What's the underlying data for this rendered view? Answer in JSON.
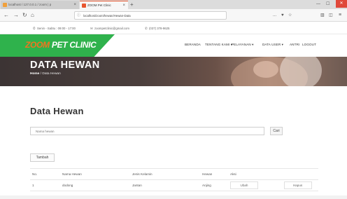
{
  "browser": {
    "tabs": [
      {
        "title": "localhost / 127.0.0.1 / zoom | p",
        "favicon_color": "#f0a03c"
      },
      {
        "title": "ZOOM Pet Clinic",
        "favicon_color": "#e8552f"
      }
    ],
    "new_tab": "+",
    "url": "localhost/zoom/hewan/Hewan-Data",
    "menu_glyph": "...",
    "nav": {
      "back": "←",
      "forward": "→",
      "reload": "↻",
      "home": "⌂"
    }
  },
  "infobar": {
    "hours": "Senin - Sabtu : 09:00 - 17:00",
    "email": "zoompetclinic@gmail.com",
    "phone": "(037) 378-9625"
  },
  "header": {
    "logo_zoom": "ZOOM",
    "logo_rest": "PET CLINIC",
    "logo_color": "#2fb24c",
    "menu": [
      "BERANDA",
      "TENTANG KAMI ▾",
      "PELAYANAN ▾",
      "DATA USER ▾",
      "ANTRI",
      "LOGOUT"
    ]
  },
  "hero": {
    "title": "DATA HEWAN",
    "crumb_home": "Home",
    "crumb_sep": "/",
    "crumb_current": "Data Hewan"
  },
  "main": {
    "title": "Data Hewan",
    "search_placeholder": "Nama hewan",
    "search_button": "Cari",
    "add_button": "Tambah",
    "table": {
      "headers": [
        "No.",
        "Nama Hewan",
        "Jenis Kelamin",
        "Hewan",
        "Aksi"
      ],
      "rows": [
        {
          "no": "1",
          "nama": "dodong",
          "jk": "Jantan",
          "hewan": "Anjing",
          "edit": "Ubah",
          "delete": "Hapus"
        }
      ]
    }
  }
}
